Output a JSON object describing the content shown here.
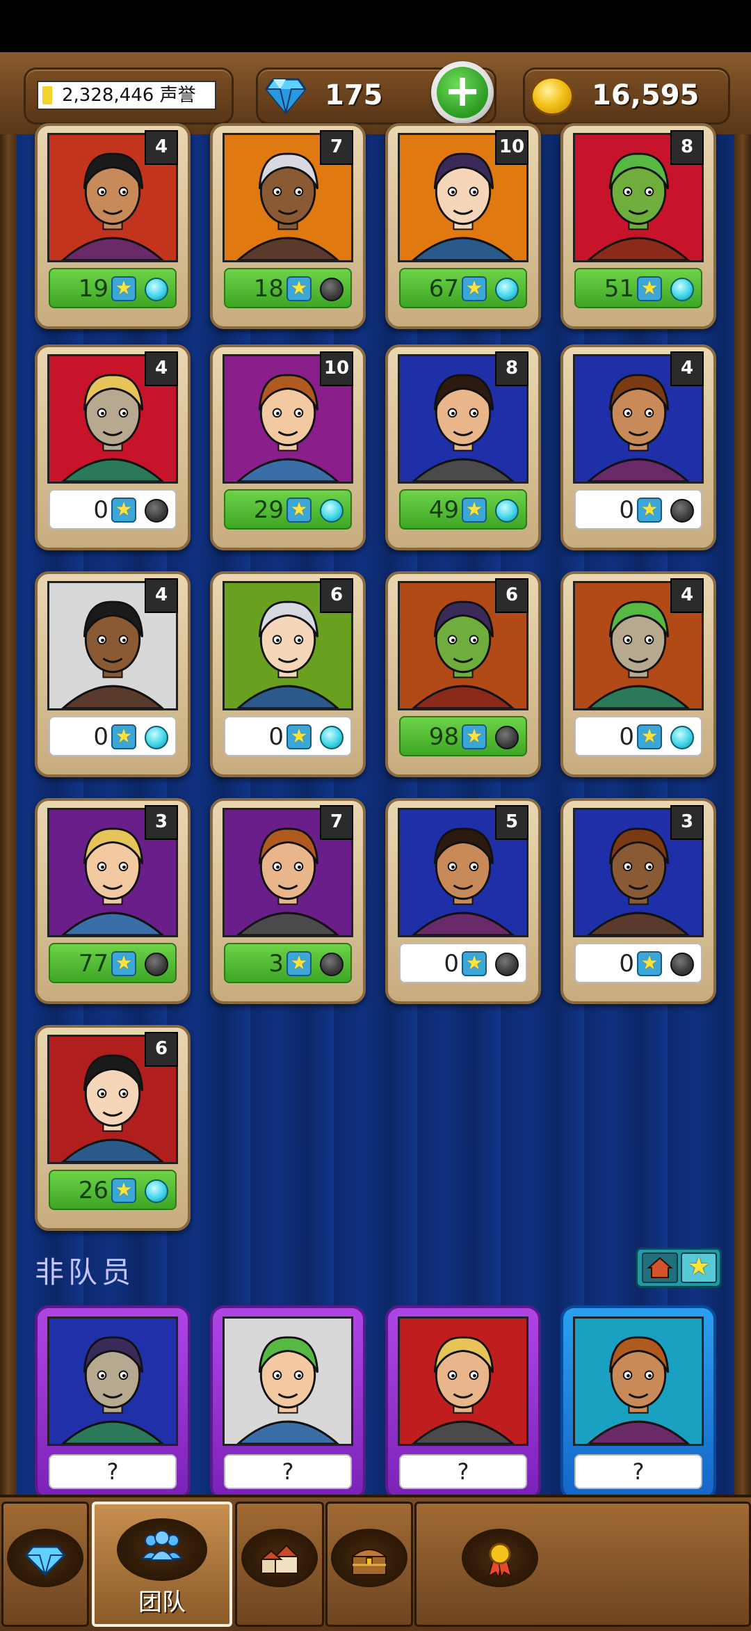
{
  "topbar": {
    "honor_text": "2,328,446 声誉",
    "gems": "175",
    "gold": "16,595"
  },
  "team_cards": [
    {
      "level": "4",
      "stars": "19",
      "bar": "green",
      "dot": "on",
      "bg": "#c2341e"
    },
    {
      "level": "7",
      "stars": "18",
      "bar": "green",
      "dot": "off",
      "bg": "#e07a10"
    },
    {
      "level": "10",
      "stars": "67",
      "bar": "green",
      "dot": "on",
      "bg": "#e07a10"
    },
    {
      "level": "8",
      "stars": "51",
      "bar": "green",
      "dot": "on",
      "bg": "#c8142a"
    },
    {
      "level": "4",
      "stars": "0",
      "bar": "white",
      "dot": "off",
      "bg": "#c8142a"
    },
    {
      "level": "10",
      "stars": "29",
      "bar": "green",
      "dot": "on",
      "bg": "#8a1e8a"
    },
    {
      "level": "8",
      "stars": "49",
      "bar": "green",
      "dot": "on",
      "bg": "#1f2fa8"
    },
    {
      "level": "4",
      "stars": "0",
      "bar": "white",
      "dot": "off",
      "bg": "#1f2fa8"
    },
    {
      "level": "4",
      "stars": "0",
      "bar": "white",
      "dot": "on",
      "bg": "#d8d8d8"
    },
    {
      "level": "6",
      "stars": "0",
      "bar": "white",
      "dot": "on",
      "bg": "#6aa020"
    },
    {
      "level": "6",
      "stars": "98",
      "bar": "green",
      "dot": "off",
      "bg": "#b24a18"
    },
    {
      "level": "4",
      "stars": "0",
      "bar": "white",
      "dot": "on",
      "bg": "#b24a18"
    },
    {
      "level": "3",
      "stars": "77",
      "bar": "green",
      "dot": "off",
      "bg": "#6a1e8a"
    },
    {
      "level": "7",
      "stars": "3",
      "bar": "green",
      "dot": "off",
      "bg": "#6a1e8a"
    },
    {
      "level": "5",
      "stars": "0",
      "bar": "white",
      "dot": "off",
      "bg": "#1f2fa8"
    },
    {
      "level": "3",
      "stars": "0",
      "bar": "white",
      "dot": "off",
      "bg": "#1f2fa8"
    },
    {
      "level": "6",
      "stars": "26",
      "bar": "green",
      "dot": "on",
      "bg": "#b01e1e"
    }
  ],
  "non_members": {
    "title": "非队员",
    "cards": [
      {
        "label": "?",
        "frame": "purple",
        "bg": "#2030a8"
      },
      {
        "label": "?",
        "frame": "purple",
        "bg": "#d8d8d8"
      },
      {
        "label": "?",
        "frame": "purple",
        "bg": "#c01e1e"
      },
      {
        "label": "?",
        "frame": "blue",
        "bg": "#1aa0c0"
      }
    ]
  },
  "nav": {
    "team_label": "团队"
  },
  "colors": {
    "board": "#0f3180",
    "wood": "#6b4420",
    "green_bar": "#3da624",
    "dot_on": "#3fd6e8",
    "dot_off": "#3a3a3a",
    "star": "#ffe23a"
  }
}
